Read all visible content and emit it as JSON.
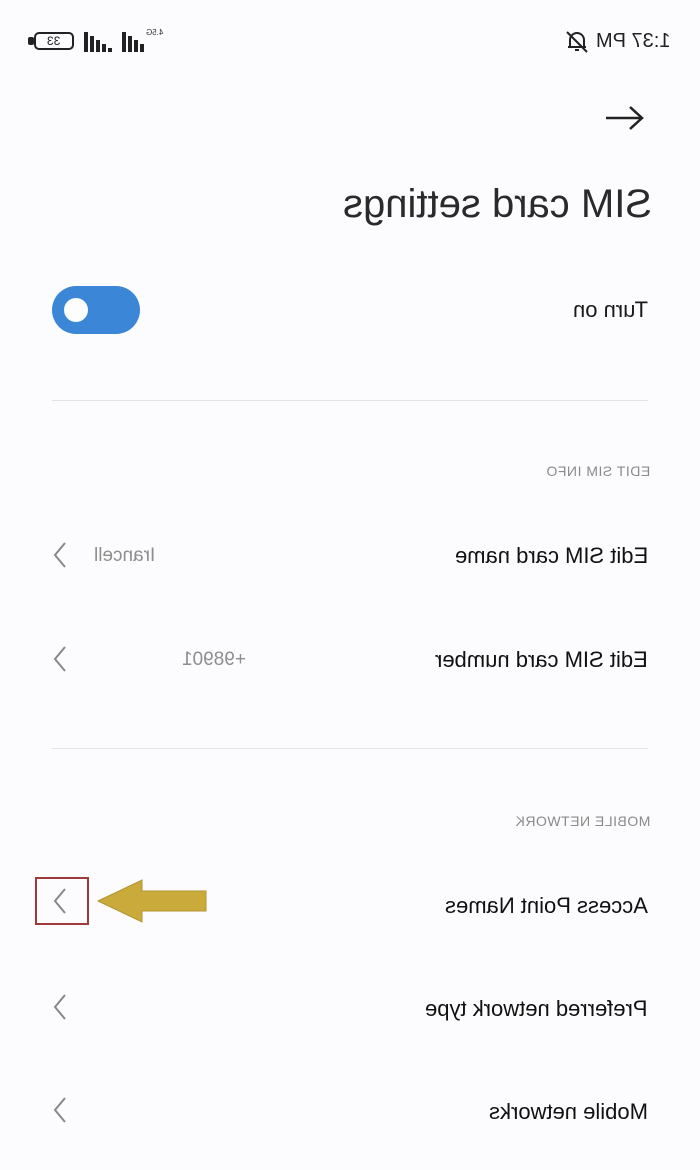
{
  "status_bar": {
    "time": "1:37 PM",
    "battery": "33",
    "network_type": "4.5G"
  },
  "header": {
    "back_icon": "arrow-icon",
    "title": "SIM card settings"
  },
  "toggle": {
    "label": "Turn on",
    "state": "on"
  },
  "sections": {
    "edit_sim_info": {
      "header": "EDIT SIM INFO",
      "items": [
        {
          "label": "Edit SIM card name",
          "value": "Irancell"
        },
        {
          "label": "Edit SIM card number",
          "value": "+98901"
        }
      ]
    },
    "mobile_network": {
      "header": "MOBILE NETWORK",
      "items": [
        {
          "label": "Access Point Names"
        },
        {
          "label": "Preferred network type"
        },
        {
          "label": "Mobile networks"
        }
      ]
    }
  },
  "colors": {
    "toggle_on": "#3b86d6",
    "highlight_box": "#9e3a3a",
    "pointer_arrow": "#c9aa3a"
  }
}
